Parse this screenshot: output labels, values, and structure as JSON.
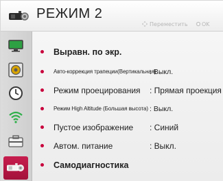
{
  "header": {
    "title": "РЕЖИМ 2",
    "hint_move": "Переместить",
    "hint_ok": "OK"
  },
  "sidebar": {
    "items": [
      {
        "icon": "monitor-icon"
      },
      {
        "icon": "speaker-icon"
      },
      {
        "icon": "clock-icon"
      },
      {
        "icon": "wifi-icon"
      },
      {
        "icon": "toolbox-icon"
      },
      {
        "icon": "projector-camera-icon",
        "active": true
      }
    ]
  },
  "menu": {
    "rows": [
      {
        "label": "Выравн. по экр.",
        "value": ""
      },
      {
        "label": "Авто-коррекция трапеции(Вертикальная)",
        "value": ": Выкл."
      },
      {
        "label": "Режим проецирования",
        "value": ": Прямая проекция"
      },
      {
        "label": "Режим High Altitude (Большая высота)",
        "value": ": Выкл."
      },
      {
        "label": "Пустое изображение",
        "value": ": Синий"
      },
      {
        "label": "Автом. питание",
        "value": ": Выкл."
      },
      {
        "label": "Самодиагностика",
        "value": ""
      }
    ]
  },
  "colors": {
    "accent": "#c8003c",
    "active_tab": "#b8184a",
    "sidebar_bg": "#d5d5d5"
  }
}
